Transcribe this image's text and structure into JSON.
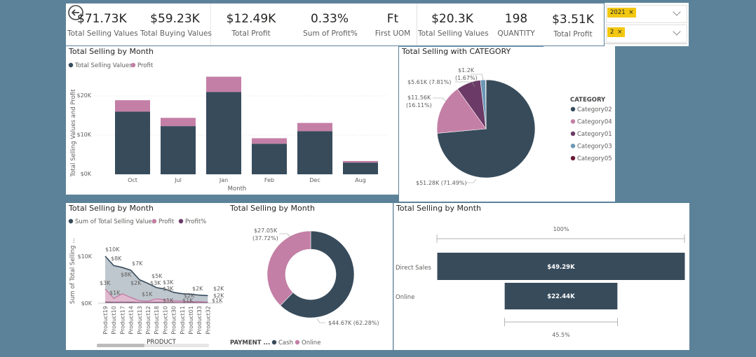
{
  "kpis_left": [
    {
      "value": "$71.73K",
      "label": "Total Selling Values"
    },
    {
      "value": "$59.23K",
      "label": "Total Buying Values"
    },
    {
      "value": "$12.49K",
      "label": "Total Profit"
    },
    {
      "value": "0.33%",
      "label": "Sum of Profit%"
    },
    {
      "value": "Ft",
      "label": "First UOM"
    }
  ],
  "kpis_right": [
    {
      "value": "$20.3K",
      "label": "Total Selling Values"
    },
    {
      "value": "198",
      "label": "QUANTITY"
    },
    {
      "value": "$3.51K",
      "label": "Total Profit"
    }
  ],
  "slicers": [
    {
      "chip": "2021",
      "remove": "×"
    },
    {
      "chip": "2",
      "remove": "×"
    }
  ],
  "charts": {
    "month_stacked": {
      "title": "Total Selling by Month",
      "legend": [
        "Total Selling Values",
        "Profit"
      ],
      "ylabel": "Total Selling Values and Profit",
      "xlabel": "Month",
      "yticks": [
        "$20K",
        "$10K",
        "$0K"
      ]
    },
    "category_pie": {
      "title": "Total Selling with CATEGORY",
      "legend_title": "CATEGORY",
      "legend": [
        "Category02",
        "Category04",
        "Category01",
        "Category03",
        "Category05"
      ],
      "labels": [
        "$1.2K",
        "(1.67%)",
        "$5.61K (7.81%)",
        "$11.56K",
        "(16.11%)",
        "$51.28K (71.49%)"
      ]
    },
    "product_area": {
      "title": "Total Selling by Month",
      "legend": [
        "Sum of Total Selling Values",
        "Profit",
        "Profit%"
      ],
      "ylabel": "Sum of Total Selling ...",
      "xlabel": "PRODUCT",
      "yticks": [
        "$10K",
        "$0K"
      ],
      "point_labels": [
        "$10K",
        "$8K",
        "$8K",
        "$7K",
        "$5K",
        "$3K",
        "$3K",
        "$3K",
        "$2K",
        "$2K",
        "$2K",
        "$3K",
        "$1K",
        "$2K",
        "$1K",
        "$1K",
        "$1K",
        "$1K",
        "$2K"
      ]
    },
    "payment_donut": {
      "title": "Total Selling by Month",
      "legend_title": "PAYMENT ...",
      "legend": [
        "Cash",
        "Online"
      ],
      "labels": [
        "$27.05K",
        "(37.72%)",
        "$44.67K (62.28%)"
      ]
    },
    "funnel": {
      "title": "Total Selling by Month",
      "top_pct": "100%",
      "bottom_pct": "45.5%",
      "rows": [
        {
          "label": "Direct Sales",
          "value": "$49.29K"
        },
        {
          "label": "Online",
          "value": "$22.44K"
        }
      ]
    }
  },
  "chart_data": [
    {
      "type": "bar",
      "title": "Total Selling by Month",
      "xlabel": "Month",
      "ylabel": "Total Selling Values and Profit",
      "categories": [
        "Oct",
        "Jul",
        "Jan",
        "Feb",
        "Dec",
        "Aug"
      ],
      "series": [
        {
          "name": "Total Selling Values",
          "values": [
            16000,
            12300,
            21000,
            7800,
            11000,
            3000
          ]
        },
        {
          "name": "Profit",
          "values": [
            2900,
            2100,
            3900,
            1400,
            2100,
            400
          ]
        }
      ],
      "ylim": [
        0,
        26000
      ],
      "stacked": true,
      "colors": [
        "#374b5b",
        "#c47fa6"
      ]
    },
    {
      "type": "pie",
      "title": "Total Selling with CATEGORY",
      "categories": [
        "Category02",
        "Category04",
        "Category01",
        "Category03",
        "Category05"
      ],
      "values": [
        51280,
        11560,
        5610,
        1200,
        80
      ],
      "colors": [
        "#374b5b",
        "#c47fa6",
        "#6b3a66",
        "#6c97b5",
        "#6a1a36"
      ]
    },
    {
      "type": "area",
      "title": "Total Selling by Month",
      "xlabel": "PRODUCT",
      "ylabel": "Sum of Total Selling ...",
      "categories": [
        "Product19",
        "Product10",
        "Product17",
        "Product14",
        "Product13",
        "Product12",
        "Product18",
        "Product10",
        "Product30",
        "Product11",
        "Product01",
        "Product33",
        "Product32"
      ],
      "series": [
        {
          "name": "Sum of Total Selling Values",
          "values": [
            10000,
            8000,
            7600,
            7000,
            5000,
            4200,
            3300,
            3000,
            2300,
            2000,
            1900,
            1700,
            1600
          ]
        },
        {
          "name": "Profit",
          "values": [
            3000,
            1000,
            2000,
            1200,
            500,
            400,
            900,
            700,
            500,
            400,
            300,
            300,
            200
          ]
        },
        {
          "name": "Profit%",
          "values": [
            200,
            150,
            180,
            170,
            120,
            130,
            160,
            140,
            110,
            100,
            120,
            90,
            100
          ]
        }
      ],
      "ylim": [
        0,
        12000
      ],
      "colors": [
        "#374b5b",
        "#c47fa6",
        "#6b3a66"
      ]
    },
    {
      "type": "pie",
      "title": "Total Selling by Month",
      "categories": [
        "Cash",
        "Online"
      ],
      "values": [
        44670,
        27050
      ],
      "colors": [
        "#374b5b",
        "#c47fa6"
      ]
    },
    {
      "type": "bar",
      "title": "Total Selling by Month",
      "categories": [
        "Direct Sales",
        "Online"
      ],
      "values": [
        49290,
        22440
      ],
      "colors": [
        "#374b5b"
      ]
    }
  ],
  "colors": {
    "background": "#5c8299",
    "primary": "#374b5b",
    "secondary": "#c47fa6",
    "tertiary": "#6b3a66",
    "chip": "#f2c811"
  }
}
